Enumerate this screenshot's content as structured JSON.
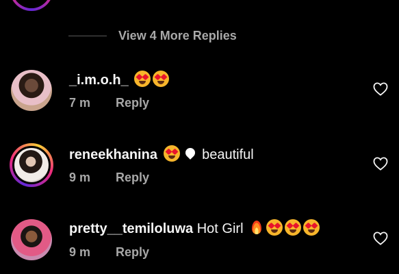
{
  "view_more": {
    "label": "View 4 More Replies"
  },
  "comments": [
    {
      "username": "_i.m.o.h_",
      "text": "",
      "emojis": [
        "heart-eyes",
        "heart-eyes"
      ],
      "time": "7 m",
      "reply_label": "Reply",
      "has_story": false
    },
    {
      "username": "reneekhanina",
      "text": "beautiful",
      "emojis": [
        "heart-eyes",
        "white-heart"
      ],
      "time": "9 m",
      "reply_label": "Reply",
      "has_story": true
    },
    {
      "username": "pretty__temiloluwa",
      "text": "Hot Girl",
      "emojis": [
        "fire",
        "heart-eyes",
        "heart-eyes",
        "heart-eyes"
      ],
      "time": "9 m",
      "reply_label": "Reply",
      "has_story": false
    }
  ],
  "colors": {
    "background": "#000000",
    "primary_text": "#f5f5f5",
    "secondary_text": "#a8a8a8",
    "story_ring": "#ee2a7b"
  },
  "icons": {
    "like": "heart-outline-icon"
  }
}
